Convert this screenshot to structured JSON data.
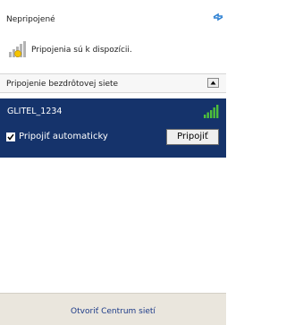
{
  "status": {
    "label": "Nepripojené"
  },
  "availability": {
    "text": "Pripojenia sú k dispozícii."
  },
  "section": {
    "title": "Pripojenie bezdrôtovej siete"
  },
  "network": {
    "ssid": "GLITEL_1234",
    "signal_bars": 5,
    "auto_connect_label": "Pripojiť automaticky",
    "auto_connect_checked": true,
    "connect_label": "Pripojiť"
  },
  "footer": {
    "link": "Otvoriť Centrum sietí"
  },
  "colors": {
    "selection": "#15336b",
    "footer_bg": "#eae6dd",
    "signal": "#4ec03a",
    "link": "#1d3b88"
  },
  "icons": [
    "refresh-icon",
    "network-status-icon",
    "collapse-arrow-icon",
    "signal-strength-icon",
    "checkmark-icon"
  ]
}
